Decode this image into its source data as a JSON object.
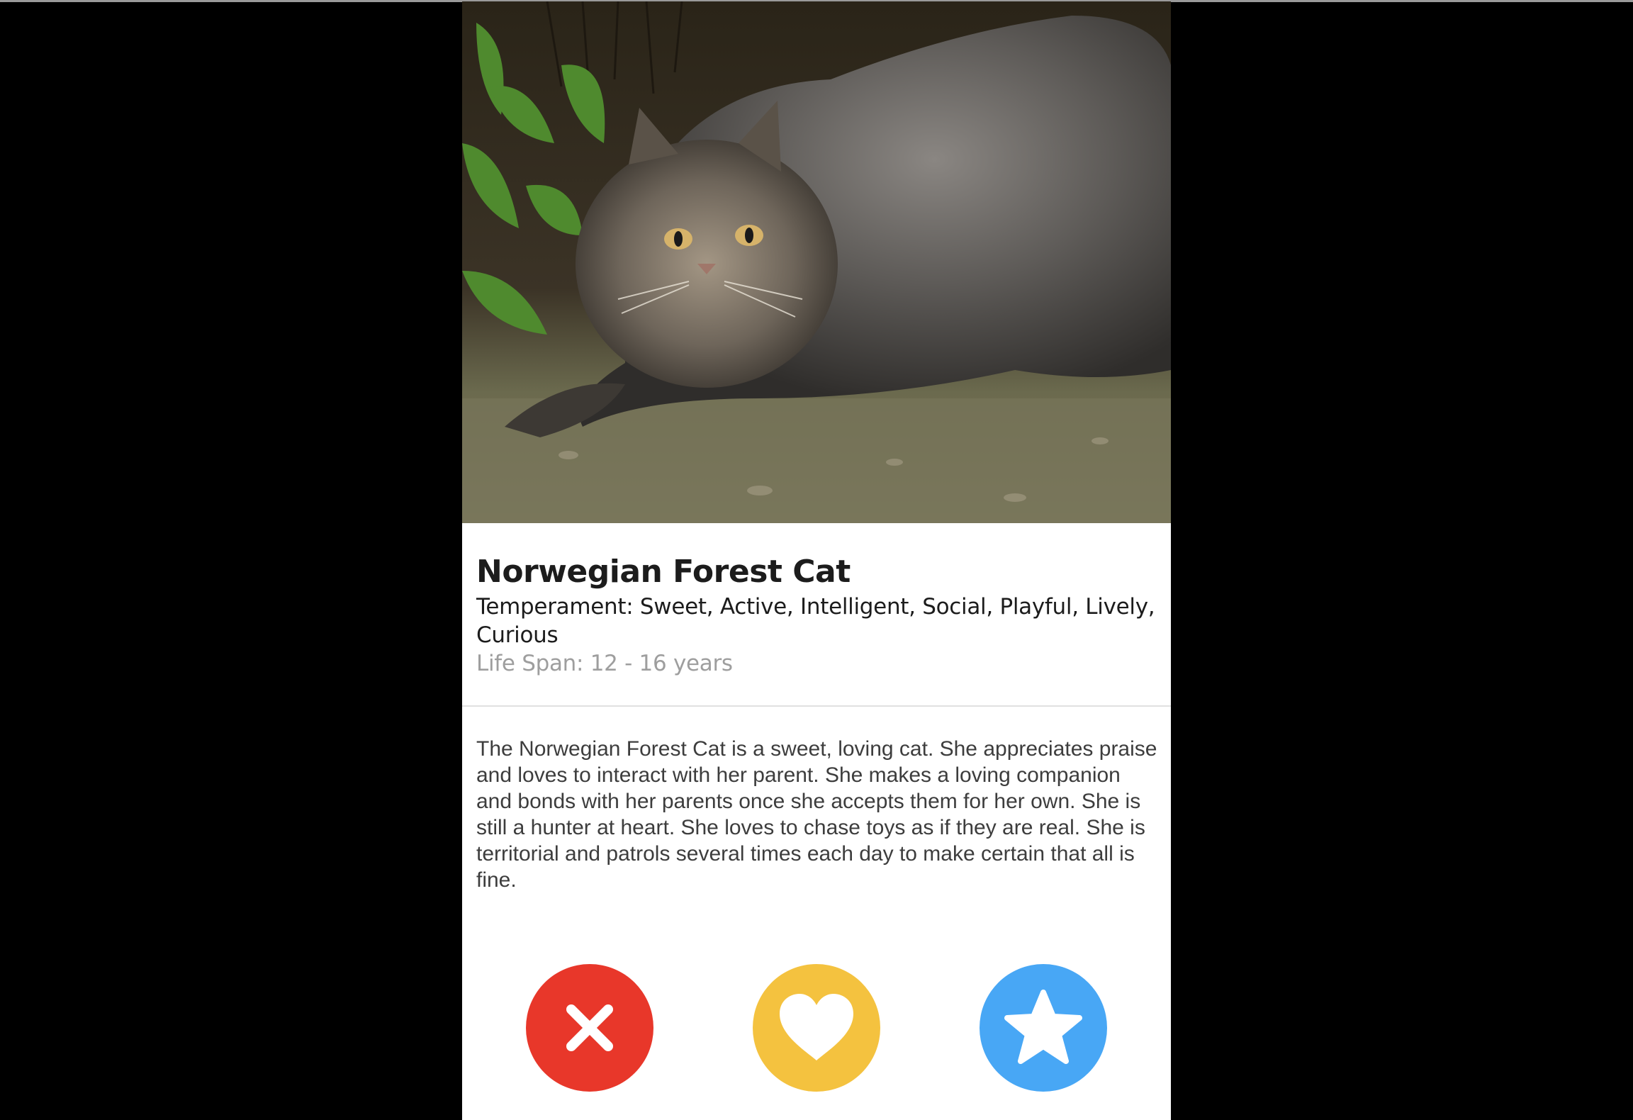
{
  "breed": {
    "name": "Norwegian Forest Cat",
    "temperament": "Temperament: Sweet, Active, Intelligent, Social, Playful, Lively, Curious",
    "life_span": "Life Span: 12 - 16 years",
    "description": "The Norwegian Forest Cat is a sweet, loving cat. She appreciates praise and loves to interact with her parent. She makes a loving companion and bonds with her parents once she accepts them for her own. She is still a hunter at heart. She loves to chase toys as if they are real. She is territorial and patrols several times each day to make certain that all is fine."
  },
  "actions": {
    "nope": {
      "icon": "close-icon",
      "color": "#e8372a"
    },
    "like": {
      "icon": "heart-icon",
      "color": "#f4c23f"
    },
    "superlike": {
      "icon": "star-icon",
      "color": "#48a7f5"
    }
  }
}
